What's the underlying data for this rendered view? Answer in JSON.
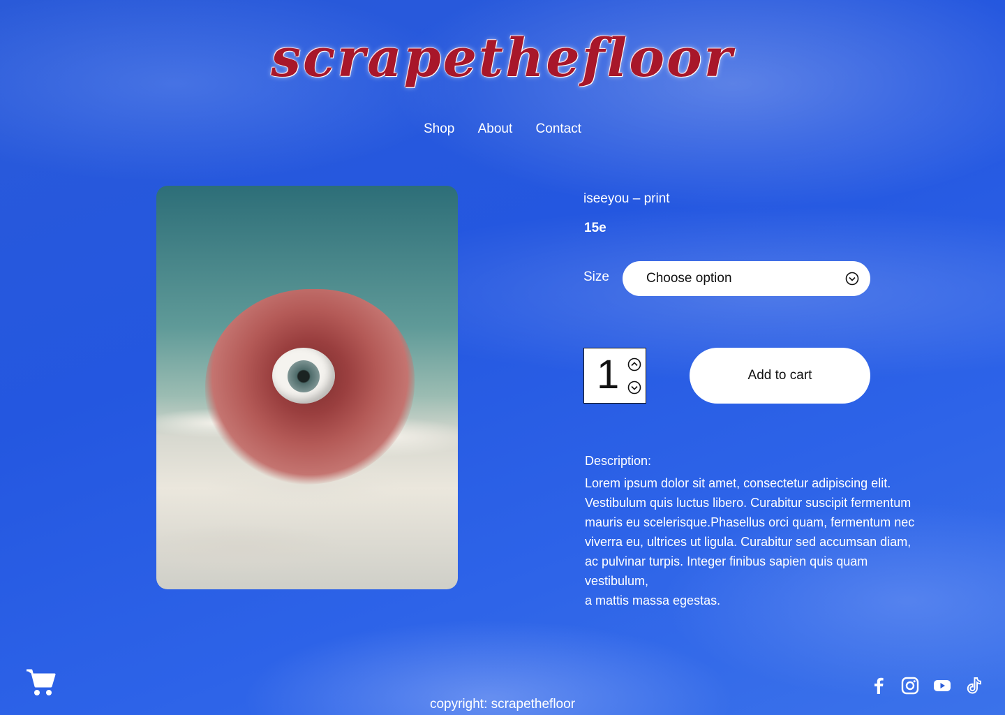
{
  "site": {
    "logo_text": "scrapethefloor"
  },
  "nav": {
    "items": [
      "Shop",
      "About",
      "Contact"
    ]
  },
  "product": {
    "title": "iseeyou – print",
    "price": "15e",
    "size_label": "Size",
    "size_placeholder": "Choose option",
    "quantity": "1",
    "add_to_cart": "Add to cart",
    "description_label": "Description:",
    "description_lines": [
      "Lorem ipsum dolor sit amet, consectetur adipiscing elit.",
      "Vestibulum quis luctus libero. Curabitur suscipit fermentum",
      "mauris eu scelerisque.Phasellus orci quam, fermentum nec",
      "viverra eu, ultrices ut ligula. Curabitur sed accumsan diam,",
      "ac pulvinar turpis. Integer finibus sapien quis quam vestibulum,",
      "a mattis massa egestas."
    ]
  },
  "footer": {
    "copyright": "copyright: scrapethefloor",
    "icons": [
      "cart-icon",
      "facebook-icon",
      "instagram-icon",
      "youtube-icon",
      "tiktok-icon"
    ]
  },
  "colors": {
    "background": "#2a5ad8",
    "logo": "#a8172a"
  }
}
